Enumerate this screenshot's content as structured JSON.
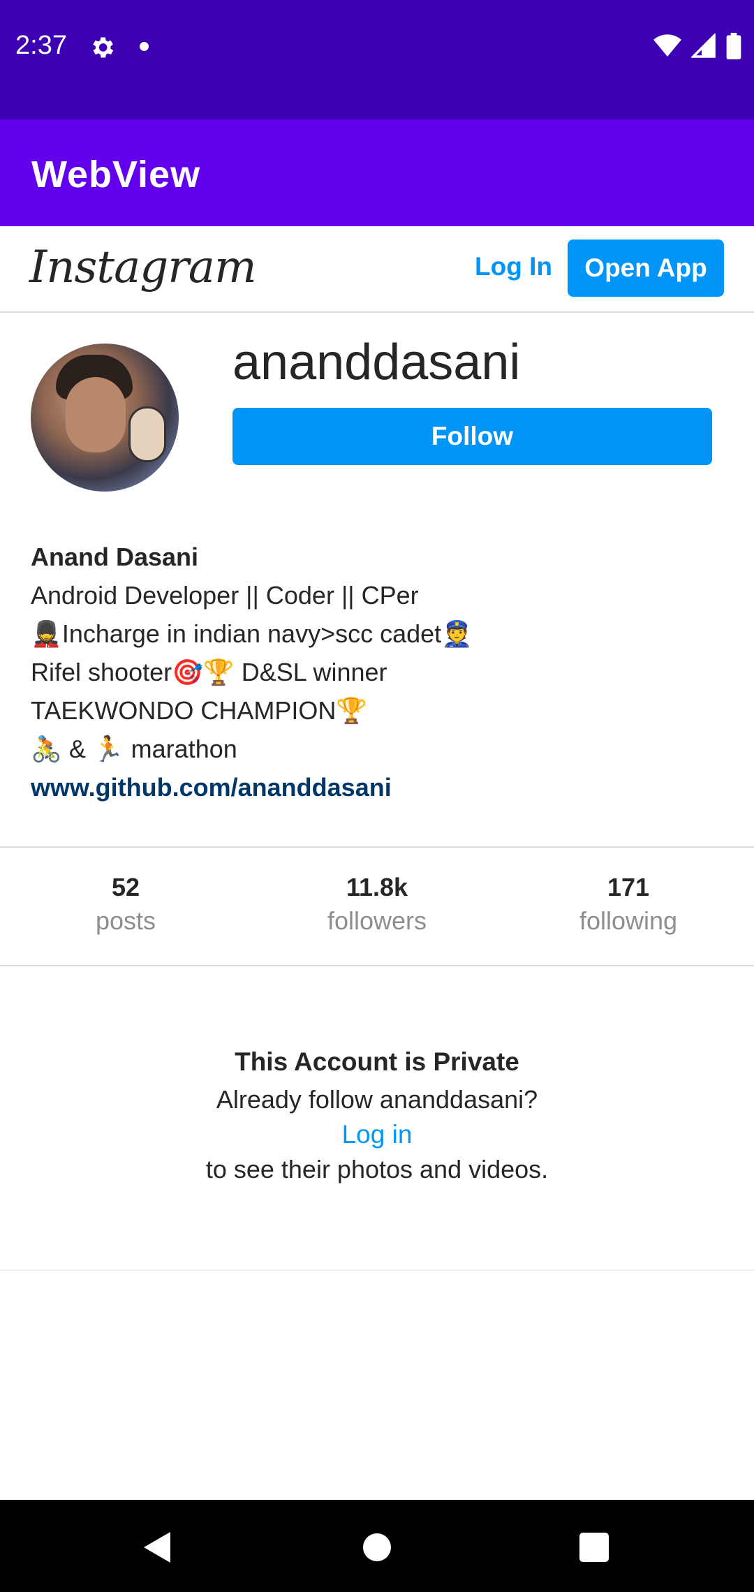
{
  "status_bar": {
    "time": "2:37",
    "icons": [
      "gear-icon",
      "notification-dot-icon",
      "wifi-icon",
      "signal-icon",
      "battery-icon"
    ],
    "background": "#3d00b2"
  },
  "app_bar": {
    "title": "WebView",
    "background": "#6200ee"
  },
  "ig_header": {
    "logo": "Instagram",
    "login_label": "Log In",
    "open_app_label": "Open App"
  },
  "profile": {
    "username": "ananddasani",
    "follow_label": "Follow",
    "bio": {
      "name": "Anand Dasani",
      "lines": [
        "Android Developer || Coder || CPer",
        "💂Incharge in indian navy>scc cadet👮",
        "Rifel shooter🎯🏆 D&SL winner",
        "TAEKWONDO CHAMPION🏆",
        "🚴 & 🏃 marathon"
      ],
      "link": "www.github.com/ananddasani"
    }
  },
  "stats": [
    {
      "value": "52",
      "label": "posts"
    },
    {
      "value": "11.8k",
      "label": "followers"
    },
    {
      "value": "171",
      "label": "following"
    }
  ],
  "private_notice": {
    "title": "This Account is Private",
    "line1": "Already follow ananddasani?",
    "login_link": "Log in",
    "line2": "to see their photos and videos."
  },
  "colors": {
    "accent": "#0095f6",
    "link_dark": "#00376b",
    "text": "#262626",
    "muted": "#8e8e8e"
  }
}
